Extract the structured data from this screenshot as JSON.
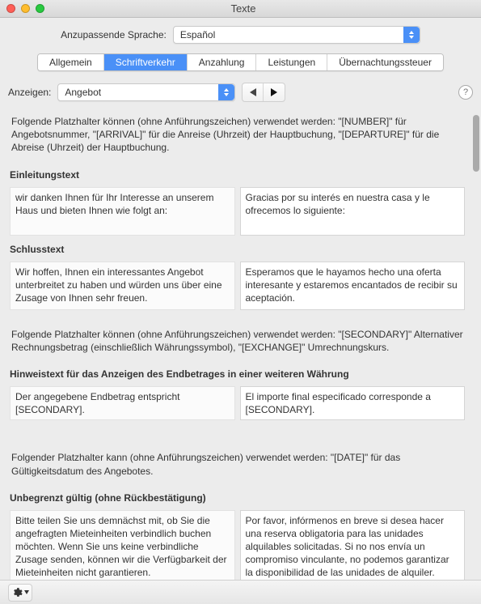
{
  "window": {
    "title": "Texte"
  },
  "language": {
    "label": "Anzupassende Sprache:",
    "value": "Español"
  },
  "tabs": [
    {
      "label": "Allgemein",
      "active": false
    },
    {
      "label": "Schriftverkehr",
      "active": true
    },
    {
      "label": "Anzahlung",
      "active": false
    },
    {
      "label": "Leistungen",
      "active": false
    },
    {
      "label": "Übernachtungssteuer",
      "active": false
    }
  ],
  "show": {
    "label": "Anzeigen:",
    "value": "Angebot"
  },
  "help": "?",
  "texts": {
    "placeholders1": "Folgende Platzhalter können (ohne Anführungszeichen)  verwendet werden: \"[NUMBER]\" für Angebotsnummer, \"[ARRIVAL]\" für die Anreise (Uhrzeit) der Hauptbuchung, \"[DEPARTURE]\" für die Abreise (Uhrzeit) der Hauptbuchung.",
    "intro_heading": "Einleitungstext",
    "intro_source": "wir danken Ihnen für Ihr Interesse an unserem Haus und bieten Ihnen wie folgt an:",
    "intro_target": "Gracias por su interés en nuestra casa y le ofrecemos lo siguiente:",
    "closing_heading": "Schlusstext",
    "closing_source": "Wir hoffen, Ihnen ein interessantes Angebot unterbreitet zu haben und würden uns über eine Zusage von Ihnen sehr freuen.",
    "closing_target": "Esperamos que le hayamos hecho una oferta interesante y estaremos encantados de recibir su aceptación.",
    "placeholders2": "Folgende Platzhalter können (ohne Anführungszeichen) verwendet werden: \"[SECONDARY]\" Alternativer Rechnungsbetrag (einschließlich Währungssymbol), \"[EXCHANGE]\" Umrechnungskurs.",
    "secondary_heading": "Hinweistext für das Anzeigen des Endbetrages in einer weiteren Währung",
    "secondary_source": "Der angegebene Endbetrag entspricht [SECONDARY].",
    "secondary_target": "El importe final especificado corresponde a [SECONDARY].",
    "placeholders3": "Folgender Platzhalter kann (ohne Anführungszeichen) verwendet werden: \"[DATE]\" für das Gültigkeitsdatum des Angebotes.",
    "unlimited_heading": "Unbegrenzt gültig (ohne Rückbestätigung)",
    "unlimited_source": "Bitte teilen Sie uns demnächst mit, ob Sie die angefragten Mieteinheiten verbindlich buchen möchten. Wenn Sie uns keine verbindliche Zusage senden, können wir die Verfügbarkeit der Mieteinheiten nicht garantieren.",
    "unlimited_target": "Por favor, infórmenos en breve si desea hacer una reserva obligatoria para las unidades alquilables solicitadas. Si no nos envía un compromiso vinculante, no podemos garantizar la disponibilidad de las unidades de alquiler."
  }
}
